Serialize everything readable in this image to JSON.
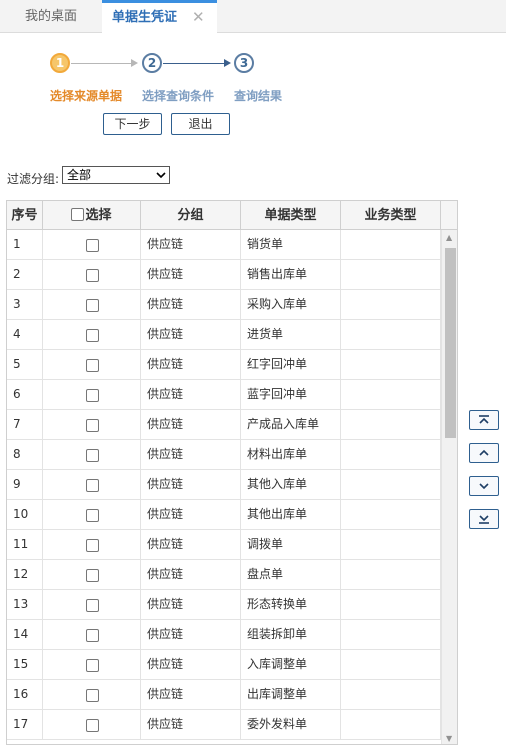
{
  "tabs": {
    "home": "我的桌面",
    "active": "单据生凭证",
    "close": "✕"
  },
  "steps": [
    {
      "num": "1",
      "label": "选择来源单据",
      "active": true
    },
    {
      "num": "2",
      "label": "选择查询条件",
      "active": false
    },
    {
      "num": "3",
      "label": "查询结果",
      "active": false
    }
  ],
  "buttons": {
    "next": "下一步",
    "exit": "退出"
  },
  "filter": {
    "label": "过滤分组:",
    "value": "全部"
  },
  "grid": {
    "columns": {
      "seq": "序号",
      "select": "选择",
      "group": "分组",
      "doc_type": "单据类型",
      "biz_type": "业务类型"
    },
    "rows": [
      {
        "seq": "1",
        "group": "供应链",
        "doc_type": "销货单",
        "biz_type": ""
      },
      {
        "seq": "2",
        "group": "供应链",
        "doc_type": "销售出库单",
        "biz_type": ""
      },
      {
        "seq": "3",
        "group": "供应链",
        "doc_type": "采购入库单",
        "biz_type": ""
      },
      {
        "seq": "4",
        "group": "供应链",
        "doc_type": "进货单",
        "biz_type": ""
      },
      {
        "seq": "5",
        "group": "供应链",
        "doc_type": "红字回冲单",
        "biz_type": ""
      },
      {
        "seq": "6",
        "group": "供应链",
        "doc_type": "蓝字回冲单",
        "biz_type": ""
      },
      {
        "seq": "7",
        "group": "供应链",
        "doc_type": "产成品入库单",
        "biz_type": ""
      },
      {
        "seq": "8",
        "group": "供应链",
        "doc_type": "材料出库单",
        "biz_type": ""
      },
      {
        "seq": "9",
        "group": "供应链",
        "doc_type": "其他入库单",
        "biz_type": ""
      },
      {
        "seq": "10",
        "group": "供应链",
        "doc_type": "其他出库单",
        "biz_type": ""
      },
      {
        "seq": "11",
        "group": "供应链",
        "doc_type": "调拨单",
        "biz_type": ""
      },
      {
        "seq": "12",
        "group": "供应链",
        "doc_type": "盘点单",
        "biz_type": ""
      },
      {
        "seq": "13",
        "group": "供应链",
        "doc_type": "形态转换单",
        "biz_type": ""
      },
      {
        "seq": "14",
        "group": "供应链",
        "doc_type": "组装拆卸单",
        "biz_type": ""
      },
      {
        "seq": "15",
        "group": "供应链",
        "doc_type": "入库调整单",
        "biz_type": ""
      },
      {
        "seq": "16",
        "group": "供应链",
        "doc_type": "出库调整单",
        "biz_type": ""
      },
      {
        "seq": "17",
        "group": "供应链",
        "doc_type": "委外发料单",
        "biz_type": ""
      }
    ]
  },
  "side_buttons": [
    {
      "name": "move-top-icon"
    },
    {
      "name": "move-up-icon"
    },
    {
      "name": "move-down-icon"
    },
    {
      "name": "move-bottom-icon"
    }
  ],
  "colors": {
    "accent": "#3b8fe0",
    "active_step": "#e48a2a",
    "inactive_step": "#7f9ec2",
    "button_border": "#2e5f8f"
  }
}
